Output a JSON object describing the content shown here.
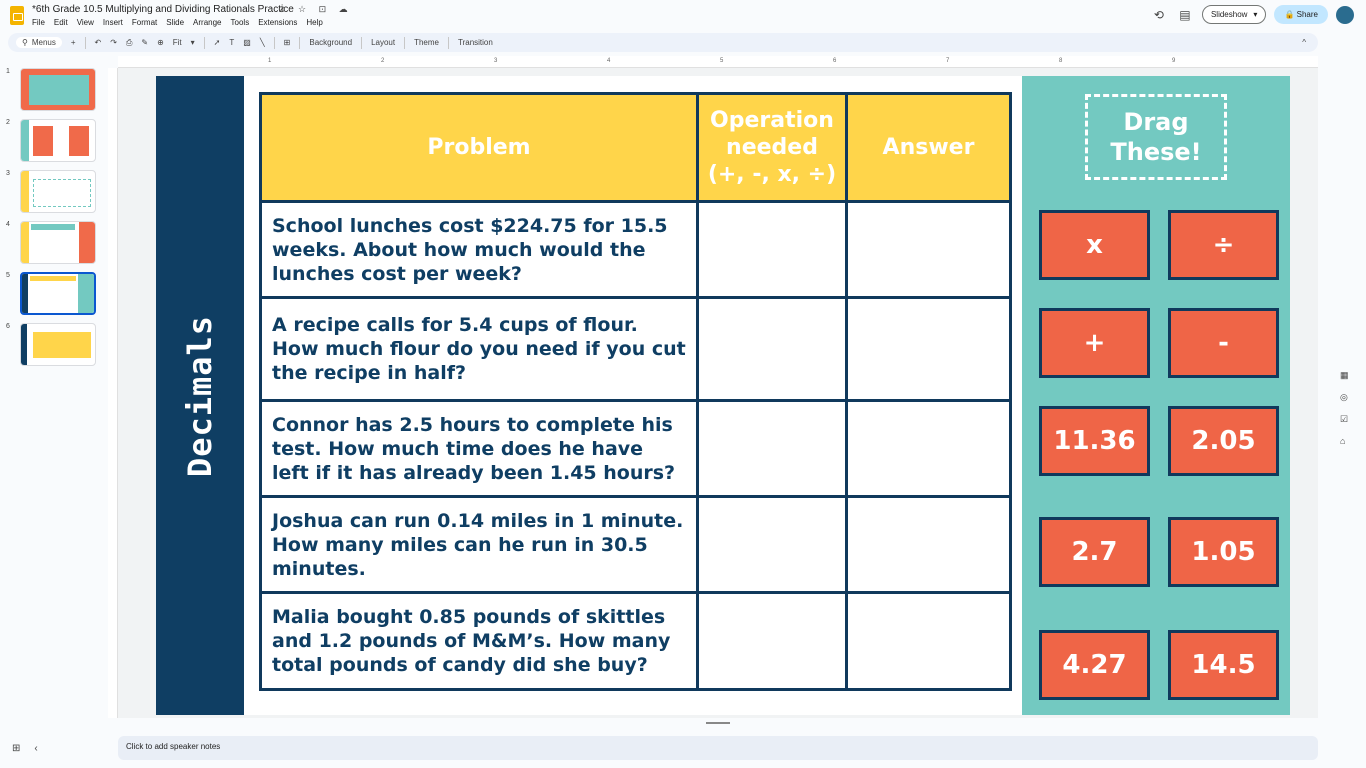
{
  "app": {
    "title": "*6th Grade 10.5 Multiplying and Dividing Rationals Practice",
    "title_icons": "⊘ ☆ ⊡ ☁",
    "menu": [
      "File",
      "Edit",
      "View",
      "Insert",
      "Format",
      "Slide",
      "Arrange",
      "Tools",
      "Extensions",
      "Help"
    ]
  },
  "header": {
    "history_icon": "history-icon",
    "comment_icon": "comment-icon",
    "slideshow_label": "Slideshow",
    "share_label": "Share",
    "share_icon": "🔒"
  },
  "toolbar": {
    "search_label": "Menus",
    "zoom_label": "Fit",
    "items": [
      "Background",
      "Layout",
      "Theme",
      "Transition"
    ],
    "collapse": "^"
  },
  "filmstrip": {
    "numbers": [
      "1",
      "2",
      "3",
      "4",
      "5",
      "6"
    ],
    "active_index": 5
  },
  "ruler": [
    "1",
    "2",
    "3",
    "4",
    "5",
    "6",
    "7",
    "8",
    "9"
  ],
  "slide": {
    "side_title": "Decimals",
    "table": {
      "headers": [
        "Problem",
        "Operation needed (+, -, x, ÷)",
        "Answer"
      ],
      "header_lines": {
        "operation_1": "Operation",
        "operation_2": "needed",
        "operation_3": "(+, -, x, ÷)"
      },
      "rows": [
        "School lunches cost $224.75 for 15.5 weeks. About how much would the lunches cost per week?",
        "A recipe calls for 5.4 cups of flour. How much flour do you need if you cut the recipe in half?",
        "Connor has 2.5 hours to complete his test. How much time does he have left if it has already been 1.45 hours?",
        "Joshua can run 0.14 miles in 1 minute. How many miles can he run in 30.5 minutes.",
        "Malia bought 0.85 pounds of skittles and 1.2 pounds of M&M’s. How many total pounds of candy did she buy?"
      ]
    },
    "drag": {
      "line1": "Drag",
      "line2": "These!"
    },
    "tiles": [
      "x",
      "÷",
      "+",
      "-",
      "11.36",
      "2.05",
      "2.7",
      "1.05",
      "4.27",
      "14.5"
    ],
    "colors": {
      "navy": "#0f3e63",
      "yellow": "#ffd54a",
      "teal": "#73c9c1",
      "orange": "#ef6547"
    }
  },
  "notes": {
    "placeholder": "Click to add speaker notes"
  }
}
